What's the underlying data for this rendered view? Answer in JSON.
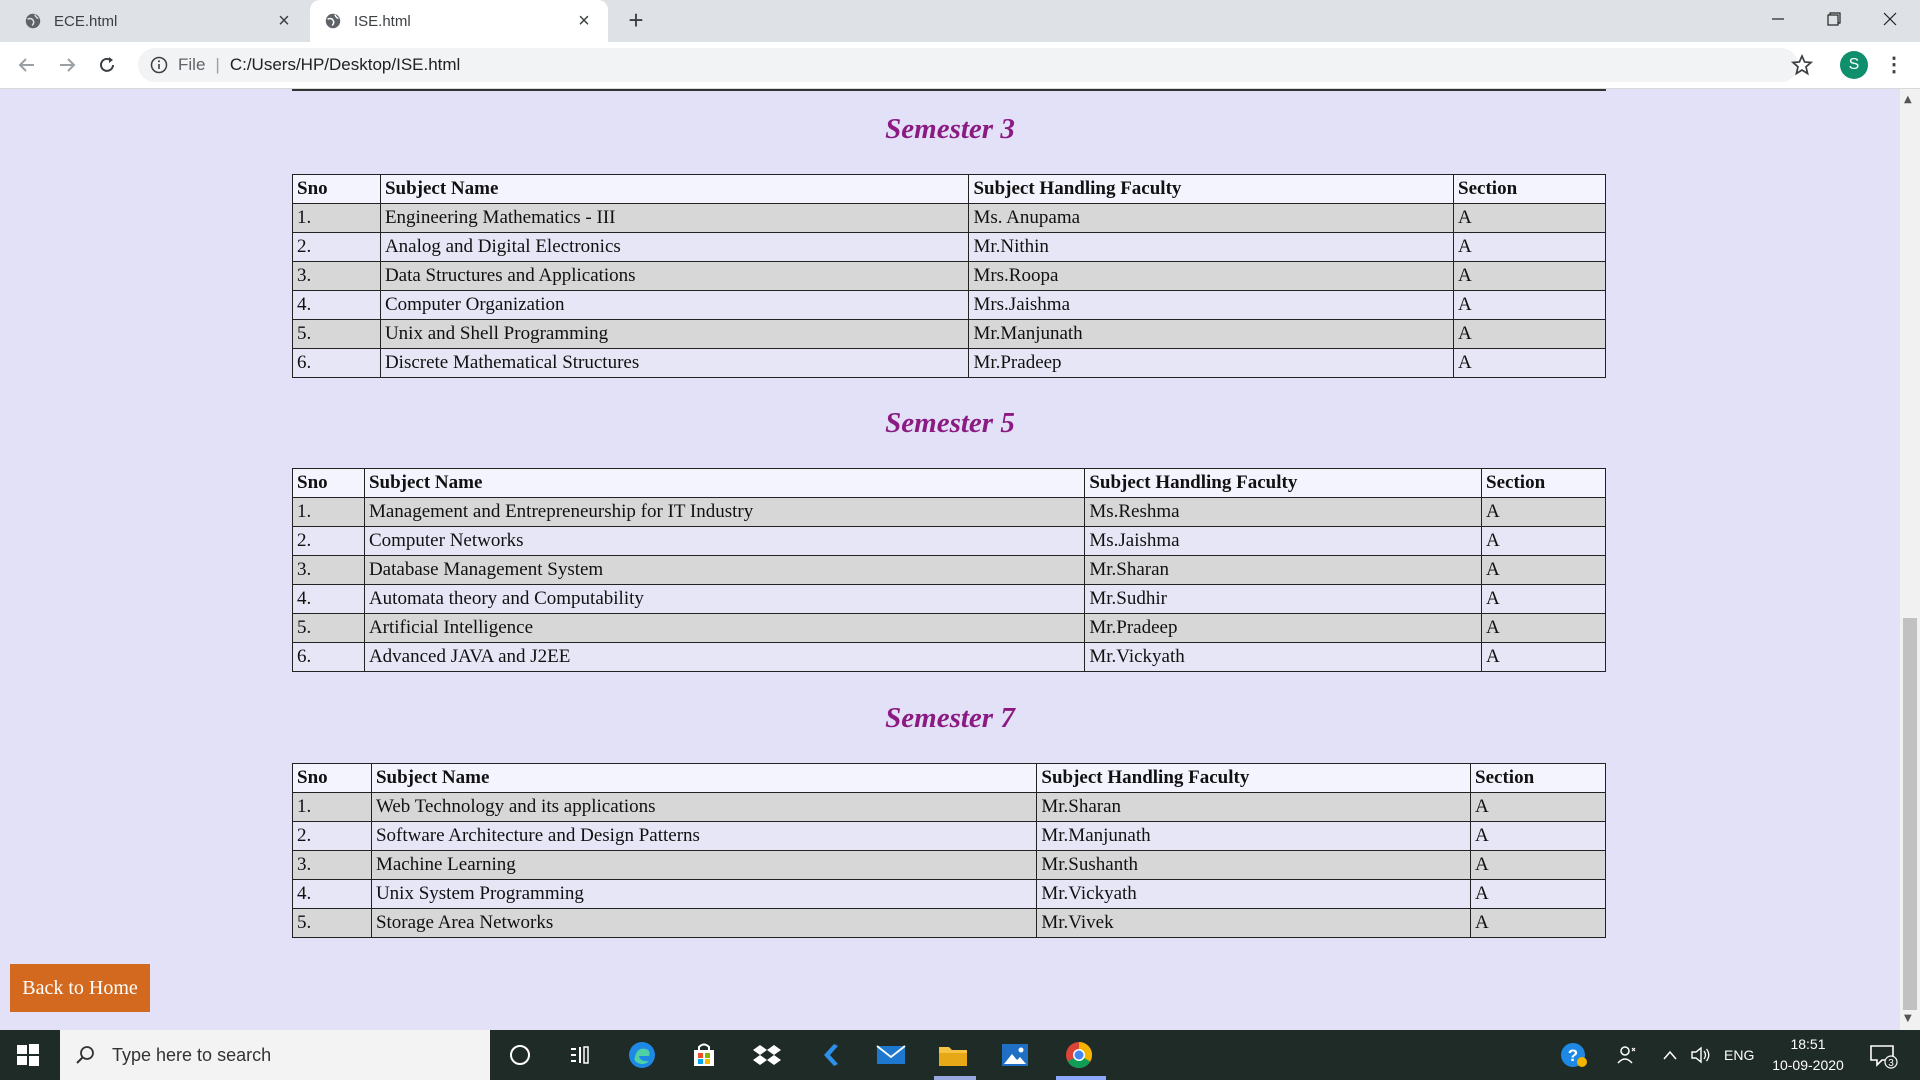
{
  "browser": {
    "tabs": [
      {
        "title": "ECE.html"
      },
      {
        "title": "ISE.html"
      }
    ],
    "address": {
      "file_label": "File",
      "url": "C:/Users/HP/Desktop/ISE.html"
    },
    "profile_initial": "S"
  },
  "columns": {
    "sno": "Sno",
    "subject": "Subject Name",
    "faculty": "Subject Handling Faculty",
    "section": "Section"
  },
  "semesters": [
    {
      "heading": "Semester 3",
      "rows": [
        {
          "sno": "1.",
          "subject": "Engineering Mathematics - III",
          "faculty": "Ms. Anupama",
          "section": "A"
        },
        {
          "sno": "2.",
          "subject": "Analog and Digital Electronics",
          "faculty": "Mr.Nithin",
          "section": "A"
        },
        {
          "sno": "3.",
          "subject": "Data Structures and Applications",
          "faculty": "Mrs.Roopa",
          "section": "A"
        },
        {
          "sno": "4.",
          "subject": "Computer Organization",
          "faculty": "Mrs.Jaishma",
          "section": "A"
        },
        {
          "sno": "5.",
          "subject": "Unix and Shell Programming",
          "faculty": "Mr.Manjunath",
          "section": "A"
        },
        {
          "sno": "6.",
          "subject": "Discrete Mathematical Structures",
          "faculty": "Mr.Pradeep",
          "section": "A"
        }
      ]
    },
    {
      "heading": "Semester 5",
      "rows": [
        {
          "sno": "1.",
          "subject": "Management and Entrepreneurship for IT Industry",
          "faculty": "Ms.Reshma",
          "section": "A"
        },
        {
          "sno": "2.",
          "subject": "Computer Networks",
          "faculty": "Ms.Jaishma",
          "section": "A"
        },
        {
          "sno": "3.",
          "subject": "Database Management System",
          "faculty": "Mr.Sharan",
          "section": "A"
        },
        {
          "sno": "4.",
          "subject": "Automata theory and Computability",
          "faculty": "Mr.Sudhir",
          "section": "A"
        },
        {
          "sno": "5.",
          "subject": "Artificial Intelligence",
          "faculty": "Mr.Pradeep",
          "section": "A"
        },
        {
          "sno": "6.",
          "subject": "Advanced JAVA and J2EE",
          "faculty": "Mr.Vickyath",
          "section": "A"
        }
      ]
    },
    {
      "heading": "Semester 7",
      "rows": [
        {
          "sno": "1.",
          "subject": "Web Technology and its applications",
          "faculty": "Mr.Sharan",
          "section": "A"
        },
        {
          "sno": "2.",
          "subject": "Software Architecture and Design Patterns",
          "faculty": "Mr.Manjunath",
          "section": "A"
        },
        {
          "sno": "3.",
          "subject": "Machine Learning",
          "faculty": "Mr.Sushanth",
          "section": "A"
        },
        {
          "sno": "4.",
          "subject": "Unix System Programming",
          "faculty": "Mr.Vickyath",
          "section": "A"
        },
        {
          "sno": "5.",
          "subject": "Storage Area Networks",
          "faculty": "Mr.Vivek",
          "section": "A"
        }
      ]
    }
  ],
  "back_button": "Back to Home",
  "taskbar": {
    "search_placeholder": "Type here to search",
    "language": "ENG",
    "time": "18:51",
    "date": "10-09-2020",
    "notification_count": "3"
  },
  "colors": {
    "page_background": "#e2e1f7",
    "heading": "#8b1a83",
    "back_button": "#d2691e"
  }
}
